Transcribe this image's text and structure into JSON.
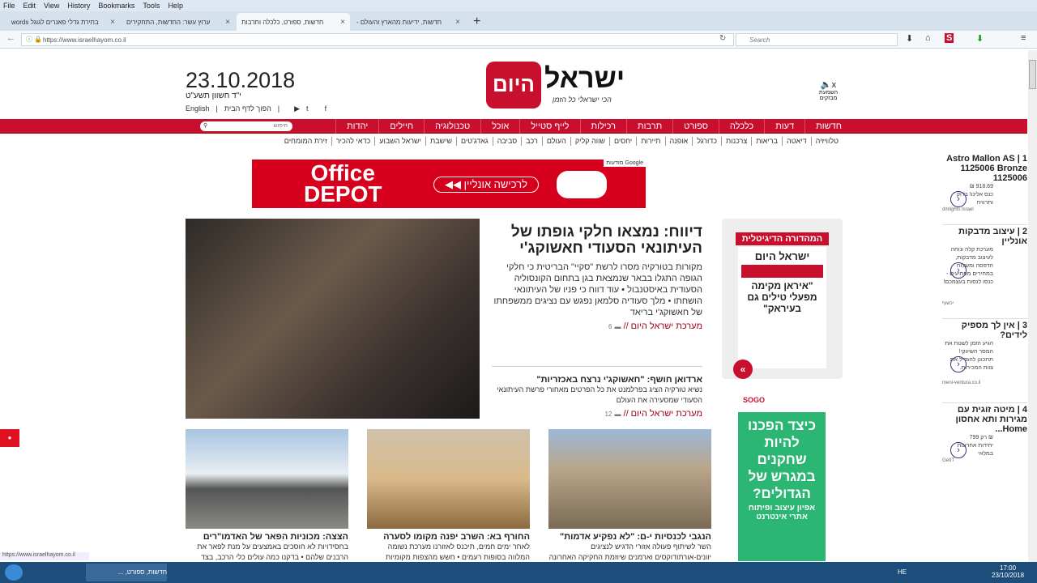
{
  "menu": [
    "File",
    "Edit",
    "View",
    "History",
    "Bookmarks",
    "Tools",
    "Help"
  ],
  "tabs": [
    {
      "label": "בחירת גדלי פאנרים לגוגל words"
    },
    {
      "label": "ערוץ עשר: החדשות, התחקירים"
    },
    {
      "label": "חדשות, ספורט, כלכלה ותרבות"
    },
    {
      "label": "חדשות, ידיעות מהארץ והעולם -"
    }
  ],
  "url": "https://www.israelhayom.co.il",
  "search_placeholder": "Search",
  "header": {
    "date": "23.10.2018",
    "hebrew_date": "י\"ד חשוון תשע\"ט",
    "english": "English",
    "homepage": "הפוך לדף הבית",
    "mute": "השמעת מבזקים",
    "logo": "ישראל היום",
    "slogan": "הכי ישראלי כל הזמן"
  },
  "nav": [
    "חדשות",
    "דעות",
    "כלכלה",
    "ספורט",
    "תרבות",
    "רכילות",
    "לייף סטייל",
    "אוכל",
    "טכנולוגיה",
    "חיילים",
    "יהדות"
  ],
  "nav_search": "חיפוש",
  "subnav": [
    "טלוויזיה",
    "דיאטה",
    "בריאות",
    "צרכנות",
    "כדורגל",
    "אופנה",
    "תיירות",
    "יחסים",
    "שווה קליק",
    "העולם",
    "רכב",
    "סביבה",
    "גאדג'טים",
    "שישבת",
    "ישראל השבוע",
    "כדאי להכיר",
    "זירת המומחים"
  ],
  "ad": {
    "brand1": "Office",
    "brand2": "DEPOT",
    "cta": "לרכישה אונליין",
    "label": "מודעות Google"
  },
  "lead": {
    "title": "דיווח: נמצאו חלקי גופתו של העיתונאי הסעודי חאשוקג'י",
    "text": "מקורות בטורקיה מסרו לרשת \"סקיי\" הבריטית כי חלקי הגופה התגלו בבאר שנמצאת בגן בתחום הקונסוליה הסעודית באיסטנבול • עוד דווח כי פניו של העיתונאי הושחתו • מלך סעודיה סלמאן נפגש עם נציגים ממשפחתו של חאשוקג'י בריאד",
    "byline": "מערכת ישראל היום //",
    "comments": "6"
  },
  "sub": {
    "title": "ארדואן חושף: \"חאשוקג'י נרצח באכזריות\"",
    "text": "נשיא טורקיה הציג בפרלמנט את כל הפרטים מאחורי פרשת העיתונאי הסעודי שמסעירה את העולם",
    "byline": "מערכת ישראל היום //",
    "comments": "12"
  },
  "cards": [
    {
      "title": "הנגבי לכנסיות י-ם: \"לא נפקיע אדמות\"",
      "text": "השר לשיתוף פעולה אזורי הדגיש לנציגים יוונים-אורתודוקסים וארמנים שיוזמת החקיקה האחרונה לא"
    },
    {
      "title": "החורף בא: השרב יפנה מקומו לסערה",
      "text": "לאחר ימים חמים, תיכנס לאזורנו מערכת נשומה המלווה בסופות רעמים • חשש מהצפות מקומיות ושיטפונות •"
    },
    {
      "title": "הצצה: מכוניות הפאר של האדמו\"רים",
      "text": "בחסידויות לא חוסכים באמצעים על מנת לפאר את הרבנים שלהם • בדקנו כמה עולים כלי הרכב, בצד"
    }
  ],
  "digital": {
    "title": "המהדורה הדיגיטלית",
    "headline": "\"איראן מקימה מפעלי טילים גם בעיראק\""
  },
  "sogo": {
    "brand": "SOGO",
    "title": "כיצד הפכנו להיות שחקנים במגרש של הגדולים?",
    "sub": "אפיון עיצוב ופיתוח אתרי אינטרנט"
  },
  "sidebar": [
    {
      "n": "1",
      "title": "Astro Mallon AS 1125006 Bronze 1125006",
      "price": "918.69 ₪",
      "desc": "כנס אלינו! בדוק ותרוויח",
      "source": "dmlights Israel"
    },
    {
      "n": "2",
      "title": "עיצוב מדבקות אונליין",
      "desc": "מערכת קלה ונוחה לעיצוב מדבקות, הדפסה ומשלוח במחירים מפתיעים - כנסו לנסות בעצמכם!",
      "source": "יכשוף"
    },
    {
      "n": "3",
      "title": "אין לך מספיק לידים?",
      "desc": "הגיע הזמן לשנות את המסר השיווקי! תתכונן להגדיל את צוות המכירות.",
      "source": "meni-ventura.co.il"
    },
    {
      "n": "4",
      "title": "מיטה זוגית עם מגירות ותא אחסון Home...",
      "price": "₪ רק 799",
      "desc": "יחידות אחרונות במלאי",
      "source": "GetIT"
    }
  ],
  "status": "https://www.israelhayom.co.il",
  "taskbar": {
    "app": "חדשות, ספורט, ...",
    "lang": "HE",
    "time": "17:00",
    "date": "23/10/2018"
  }
}
